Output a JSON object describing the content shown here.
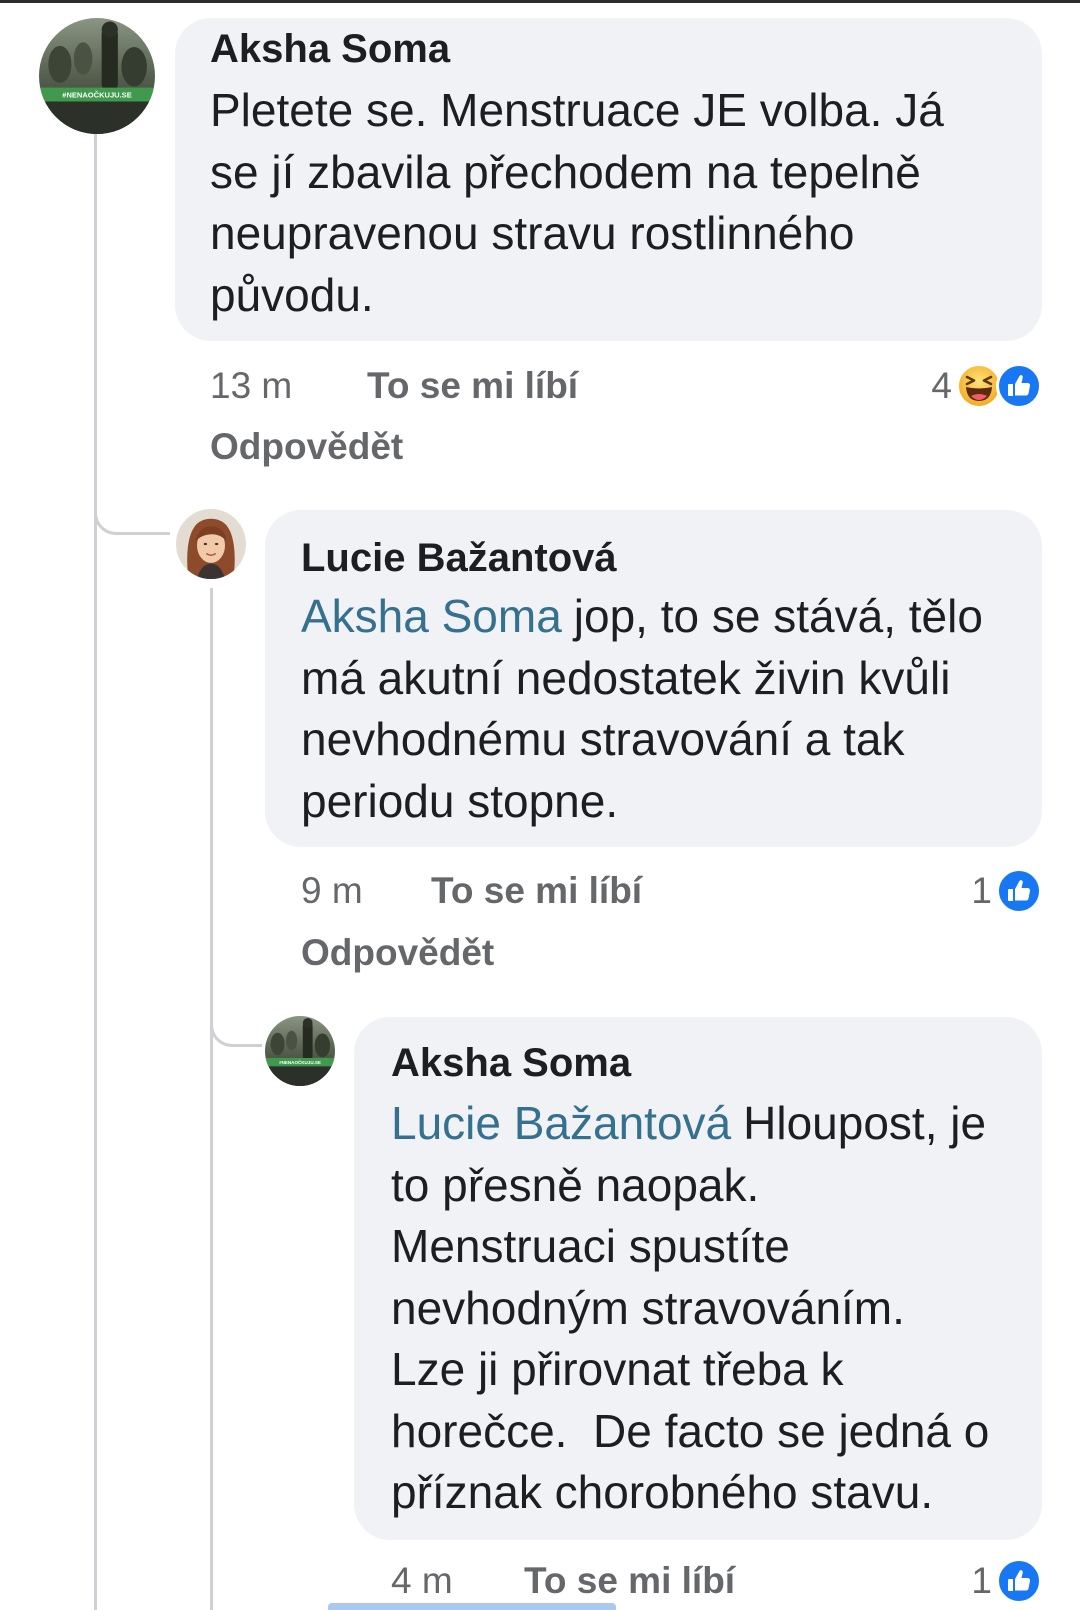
{
  "thread": {
    "comment": {
      "author": "Aksha Soma",
      "avatar_banner": "#NENAOČKUJU.SE",
      "text_lines": [
        "Pletete se. Menstruace JE volba. Já",
        "se jí zbavila přechodem na tepelně",
        "neupravenou stravu rostlinného",
        "původu."
      ],
      "time": "13 m",
      "like_label": "To se mi líbí",
      "reply_label": "Odpovědět",
      "reaction_count": "4",
      "reaction_icons": [
        "haha-icon",
        "like-icon"
      ]
    },
    "replies": [
      {
        "author": "Lucie Bažantová",
        "mention": "Aksha Soma",
        "text_lines": [
          "jop, to se stává, tělo",
          "má akutní nedostatek živin kvůli",
          "nevhodnému stravování a tak",
          "periodu stopne."
        ],
        "time": "9 m",
        "like_label": "To se mi líbí",
        "reply_label": "Odpovědět",
        "reaction_count": "1",
        "reaction_icons": [
          "like-icon"
        ]
      },
      {
        "author": "Aksha Soma",
        "mention": "Lucie Bažantová",
        "text_lines": [
          "Hloupost, je",
          "to přesně naopak.",
          "Menstruaci spustíte",
          "nevhodným stravováním.",
          "Lze ji přirovnat třeba k",
          "horečce.  De facto se jedná o",
          "příznak chorobného stavu."
        ],
        "time": "4 m",
        "like_label": "To se mi líbí",
        "reaction_count": "1",
        "reaction_icons": [
          "like-icon"
        ]
      }
    ]
  },
  "colors": {
    "bubble": "#f0f2f5",
    "mention": "#36708f",
    "meta": "#65676b",
    "like": "#1877f2",
    "line": "#ced0d4",
    "text": "#1c1e21"
  }
}
